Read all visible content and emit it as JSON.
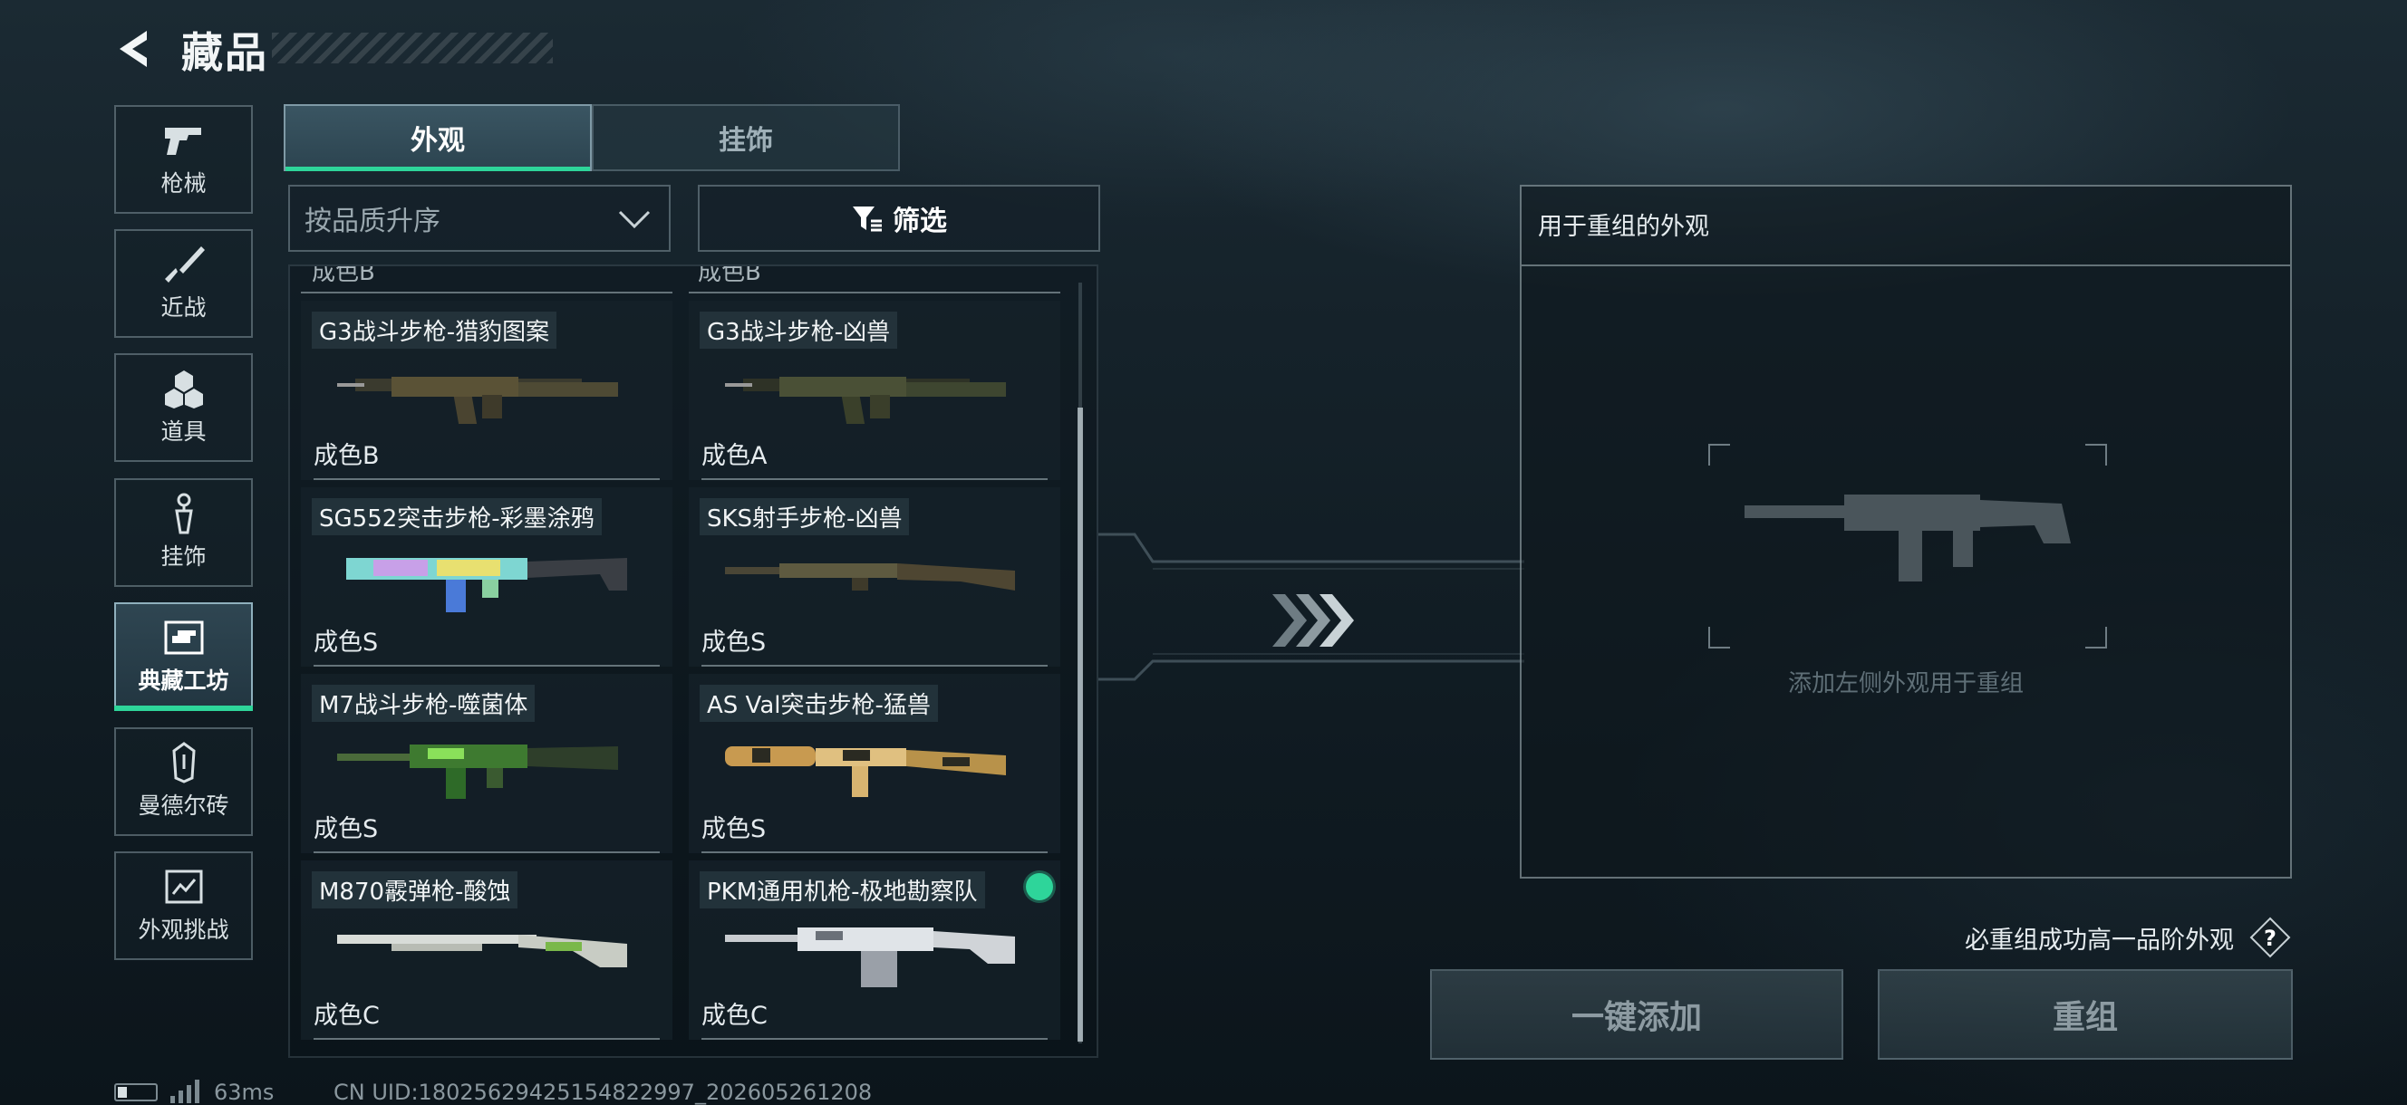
{
  "header": {
    "title": "藏品"
  },
  "categories": [
    {
      "label": "枪械",
      "icon": "pistol-icon",
      "active": false
    },
    {
      "label": "近战",
      "icon": "knife-icon",
      "active": false
    },
    {
      "label": "道具",
      "icon": "gear-items-icon",
      "active": false
    },
    {
      "label": "挂饰",
      "icon": "charm-icon",
      "active": false
    },
    {
      "label": "典藏工坊",
      "icon": "workshop-icon",
      "active": true
    },
    {
      "label": "曼德尔砖",
      "icon": "mandel-brick-icon",
      "active": false
    },
    {
      "label": "外观挑战",
      "icon": "challenge-icon",
      "active": false
    }
  ],
  "tabs": {
    "appearance": "外观",
    "pendant": "挂饰",
    "active": "appearance"
  },
  "sort": {
    "value": "按品质升序"
  },
  "filter": {
    "label": "筛选"
  },
  "list": {
    "peek_grade_left": "成色B",
    "peek_grade_right": "成色B",
    "items": [
      {
        "name": "G3战斗步枪-猎豹图案",
        "grade": "成色B",
        "skin": "leopard",
        "selected": false
      },
      {
        "name": "G3战斗步枪-凶兽",
        "grade": "成色A",
        "skin": "beast",
        "selected": false
      },
      {
        "name": "SG552突击步枪-彩墨涂鸦",
        "grade": "成色S",
        "skin": "graffiti",
        "selected": false
      },
      {
        "name": "SKS射手步枪-凶兽",
        "grade": "成色S",
        "skin": "beast",
        "selected": false
      },
      {
        "name": "M7战斗步枪-噬菌体",
        "grade": "成色S",
        "skin": "phage",
        "selected": false
      },
      {
        "name": "AS Val突击步枪-猛兽",
        "grade": "成色S",
        "skin": "tiger",
        "selected": false
      },
      {
        "name": "M870霰弹枪-酸蚀",
        "grade": "成色C",
        "skin": "acid",
        "selected": false
      },
      {
        "name": "PKM通用机枪-极地勘察队",
        "grade": "成色C",
        "skin": "arctic",
        "selected": true
      }
    ]
  },
  "panel": {
    "title": "用于重组的外观",
    "hint": "添加左侧外观用于重组"
  },
  "rule_text": "必重组成功高一品阶外观",
  "help_label": "?",
  "buttons": {
    "add_all": "一键添加",
    "reform": "重组"
  },
  "status": {
    "ping": "63ms",
    "uid": "CN UID:18025629425154822997_202605261208"
  },
  "colors": {
    "accent": "#2ed59a",
    "panel_border": "#aab9c0"
  }
}
